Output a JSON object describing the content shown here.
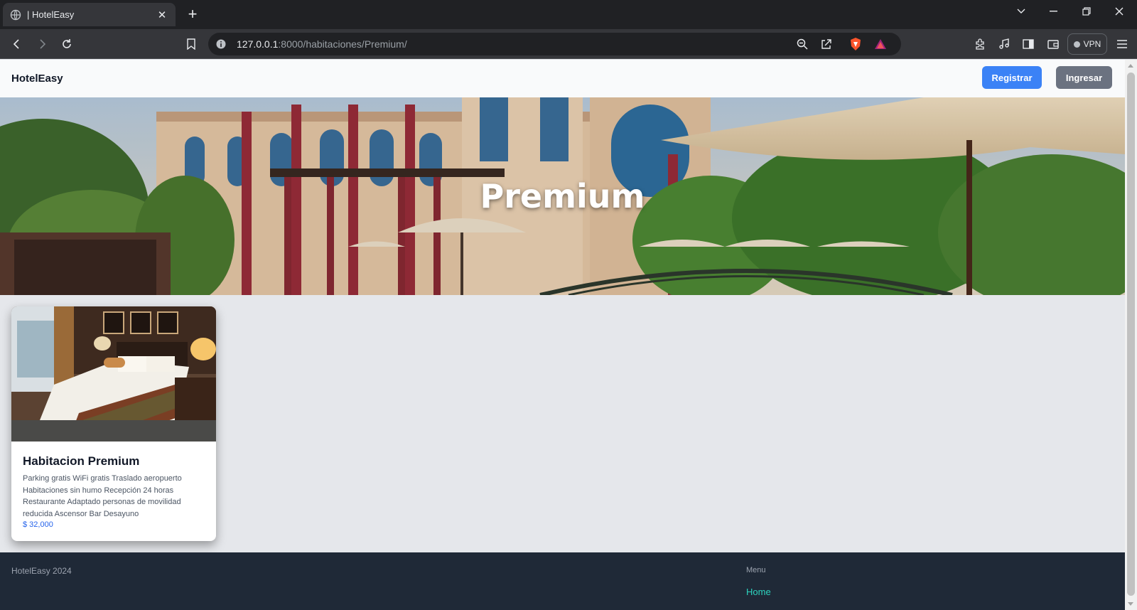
{
  "browser": {
    "tab_title": "| HotelEasy",
    "url_host": "127.0.0.1",
    "url_rest": ":8000/habitaciones/Premium/",
    "vpn_label": "VPN"
  },
  "site": {
    "brand": "HotelEasy",
    "register_label": "Registrar",
    "login_label": "Ingresar"
  },
  "hero": {
    "title": "Premium"
  },
  "rooms": [
    {
      "title": "Habitacion Premium",
      "description": "Parking gratis WiFi gratis Traslado aeropuerto Habitaciones sin humo Recepción 24 horas Restaurante Adaptado personas de movilidad reducida Ascensor Bar Desayuno",
      "price": "$ 32,000"
    }
  ],
  "footer": {
    "copyright": "HotelEasy 2024",
    "menu_heading": "Menu",
    "home_link": "Home"
  },
  "colors": {
    "register_button": "#3b82f6",
    "login_button": "#6b7280",
    "footer_bg": "#1f2937",
    "footer_link": "#2dd4bf",
    "price": "#2563eb"
  }
}
